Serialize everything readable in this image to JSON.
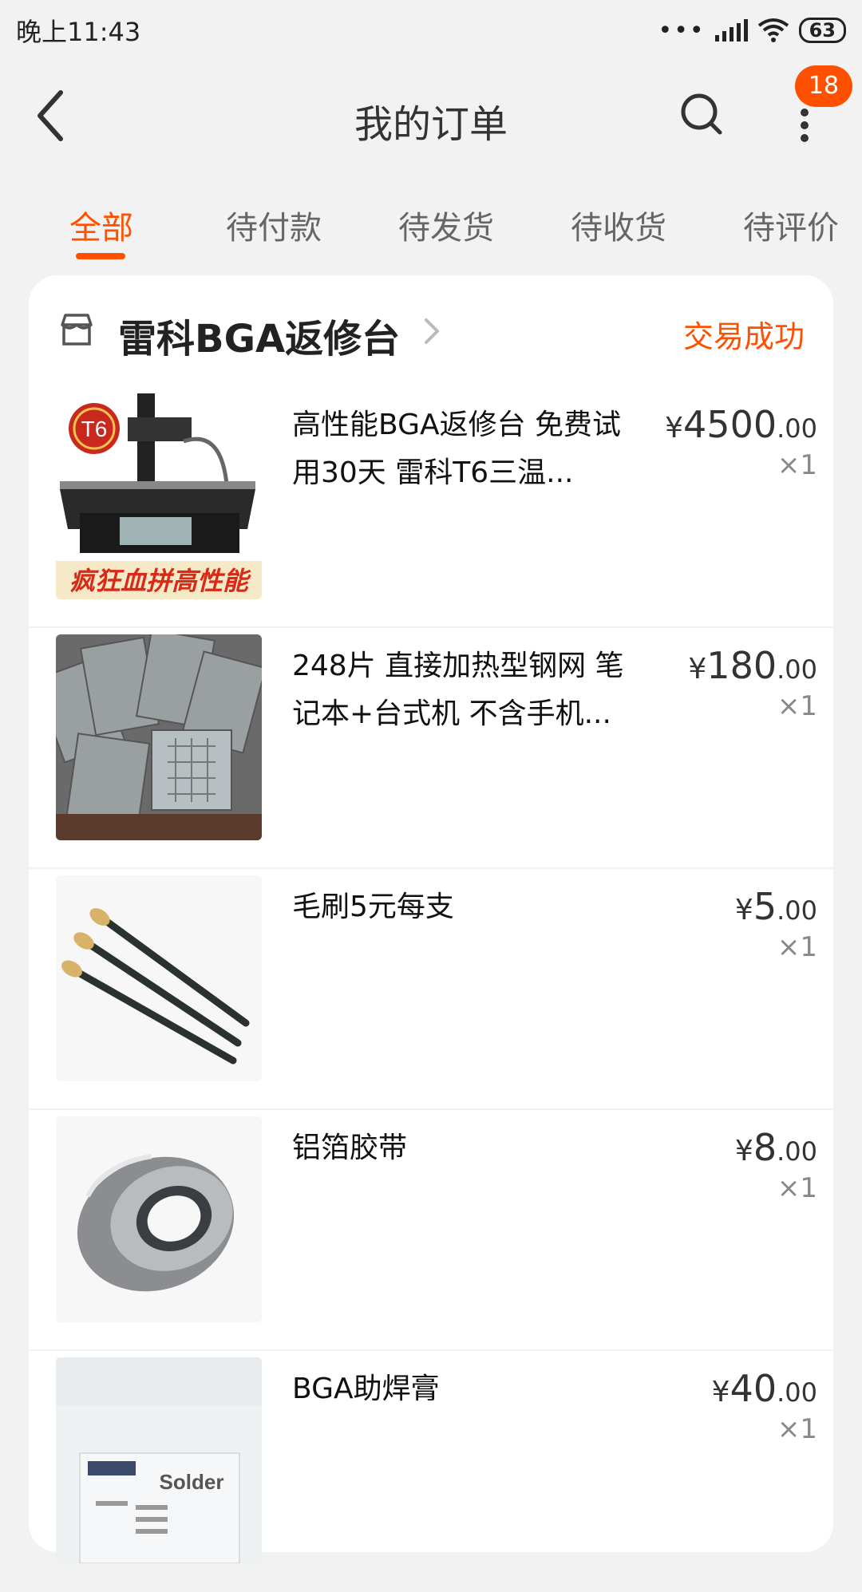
{
  "status_bar": {
    "time": "晚上11:43",
    "dots": "•••",
    "battery": "63"
  },
  "header": {
    "title": "我的订单",
    "badge_count": "18"
  },
  "tabs": [
    {
      "label": "全部",
      "active": true
    },
    {
      "label": "待付款",
      "active": false
    },
    {
      "label": "待发货",
      "active": false
    },
    {
      "label": "待收货",
      "active": false
    },
    {
      "label": "待评价",
      "active": false
    }
  ],
  "order": {
    "shop_name": "雷科BGA返修台",
    "status": "交易成功",
    "items": [
      {
        "title": "高性能BGA返修台 免费试用30天 雷科T6三温...",
        "yen": "¥",
        "price_int": "4500",
        "price_dec": ".00",
        "qty": "×1",
        "thumb_caption": "疯狂血拼高性能",
        "thumb_logo": "T6"
      },
      {
        "title": "248片 直接加热型钢网 笔记本+台式机 不含手机...",
        "yen": "¥",
        "price_int": "180",
        "price_dec": ".00",
        "qty": "×1"
      },
      {
        "title": "毛刷5元每支",
        "yen": "¥",
        "price_int": "5",
        "price_dec": ".00",
        "qty": "×1"
      },
      {
        "title": "铝箔胶带",
        "yen": "¥",
        "price_int": "8",
        "price_dec": ".00",
        "qty": "×1"
      },
      {
        "title": "BGA助焊膏",
        "yen": "¥",
        "price_int": "40",
        "price_dec": ".00",
        "qty": "×1",
        "thumb_label": "Solder"
      }
    ]
  },
  "colors": {
    "accent": "#ff5000",
    "background": "#f2f2f2",
    "card": "#ffffff"
  },
  "icons": [
    "back-icon",
    "search-icon",
    "more-icon",
    "store-icon",
    "chevron-right-icon",
    "wifi-icon",
    "signal-icon",
    "battery-icon"
  ]
}
